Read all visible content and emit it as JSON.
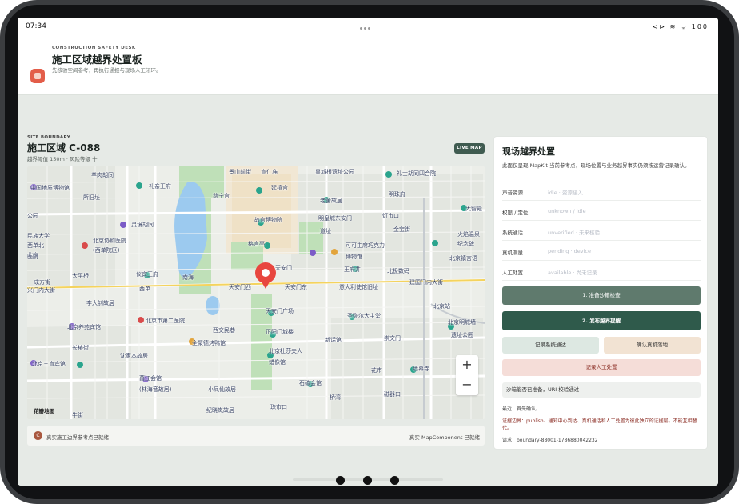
{
  "status": {
    "time": "07:34",
    "icons": "⊲⊳ ≋ ᯤ 100"
  },
  "header": {
    "eyebrow": "CONSTRUCTION SAFETY DESK",
    "title": "施工区域越界处置板",
    "subtitle": "先核验空间参考，再执行通报与现场人工闭环。"
  },
  "site": {
    "eyebrow": "SITE BOUNDARY",
    "title": "施工区域 C-088",
    "meta": "越界阈值 150m · 风险等级 十",
    "live_badge": "LIVE MAP"
  },
  "map": {
    "zoom_in": "+",
    "zoom_out": "−",
    "logo": "花瓣地图",
    "labels": [
      "景山前街",
      "宣仁庙",
      "皇城根遗址公园",
      "礼士胡同四合院",
      "羊肉胡同",
      "中国地质博物馆",
      "礼亲王府",
      "延禧宫",
      "老舍故居",
      "明珠府",
      "所旧址",
      "慈宁宫",
      "大智殿",
      "灵境胡同",
      "故宫博物院",
      "明皇城东安门",
      "灯市口",
      "公园",
      "民族大学",
      "西单北",
      "道址",
      "金宝街",
      "北京协和医院",
      "(西单院区)",
      "格言亭",
      "可可主席巧克力",
      "火焰温泉",
      "纪念碑",
      "北京",
      "医院",
      "博物馆",
      "北京镇言语",
      "太平桥",
      "仪宾王府",
      "南海",
      "天安门",
      "王府井",
      "北极数码",
      "成方街",
      "天安门东",
      "建国门内大街",
      "兴门内大街",
      "西单",
      "天安门西",
      "意大利使馆旧址",
      "李大钊故居",
      "天安门广场",
      "圣弥尔大主堂",
      "北京站",
      "北京养苑宾馆",
      "北京市第二医院",
      "正阳门城楼",
      "北京明城墙",
      "遗址公园",
      "长椿街",
      "全聚德烤鸭馆",
      "西交民巷",
      "崇文门",
      "新话馆",
      "北京三育宾馆",
      "北京杜莎夫人",
      "蜡像馆",
      "沈家本故居",
      "花市",
      "墙幕寺",
      "菖江会馆",
      "(林海音故居)",
      "石碳会馆",
      "小凤仙故居",
      "磁器口",
      "纪晓岚故居",
      "珠市口",
      "牛街",
      "桥湾"
    ]
  },
  "map_footer": {
    "avatar": "C",
    "left": "真实施工边界参考点已就绪",
    "right": "真实 MapComponent 已就绪"
  },
  "panel": {
    "title": "现场越界处置",
    "desc": "此面仅呈现 MapKit 当前参考点，现场位置与业务越界事实仍须按运营记录确认。",
    "rows": [
      {
        "k": "声音资源",
        "v": "idle · 资源接入"
      },
      {
        "k": "权限 / 定位",
        "v": "unknown / idle"
      },
      {
        "k": "系统通话",
        "v": "unverified · 未来核验"
      },
      {
        "k": "真机测量",
        "v": "pending · device"
      },
      {
        "k": "人工处置",
        "v": "available · 尚未记录"
      }
    ],
    "buttons": {
      "b1": "1. 准备沙箱检查",
      "b2": "2. 发布越界提醒",
      "b3": "记录系统通达",
      "b4": "确认真机落地",
      "b5": "记录人工处置"
    },
    "notice": "沙箱能否已准备，URI 校验通过",
    "log1": "最近：首先确认。",
    "log2": "证据边界：publish、通知中心到达、真机通话和人工处置为彼此独立的证据层，不能互相替代。",
    "log3": "请求：boundary-88001-1786880042232"
  },
  "colors": {
    "accent": "#2f5a4b",
    "danger": "#e8463f",
    "brand": "#e35d49"
  }
}
